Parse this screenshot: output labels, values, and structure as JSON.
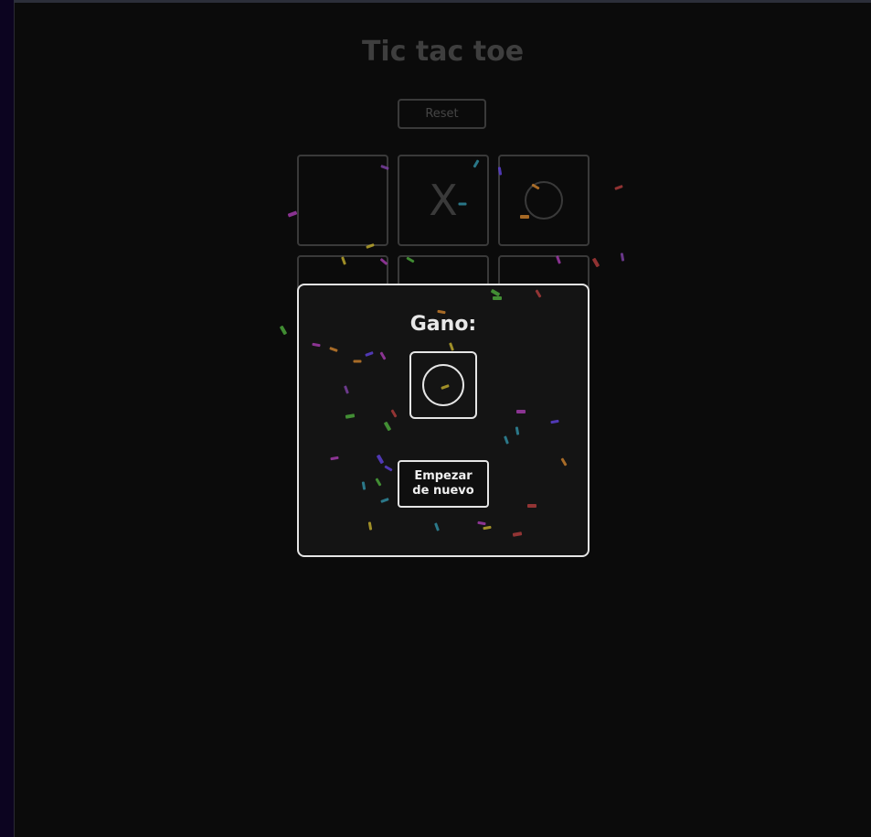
{
  "app": {
    "title": "Tic tac toe",
    "reset_label": "Reset"
  },
  "board": {
    "cells": [
      "",
      "X",
      "O",
      "",
      "",
      "",
      "",
      "",
      ""
    ]
  },
  "modal": {
    "title": "Gano:",
    "winner": "O",
    "restart_label": "Empezar\nde nuevo"
  },
  "colors": {
    "background": "#0b0b0b",
    "dim_border": "#3a3a3a",
    "modal_border": "#e5e5e5",
    "confetti": [
      "#7a3fa0",
      "#2f8a9e",
      "#c27a2a",
      "#4aa33a",
      "#b8a52c",
      "#a83a3a",
      "#a03aa8",
      "#5a3fd0"
    ]
  }
}
